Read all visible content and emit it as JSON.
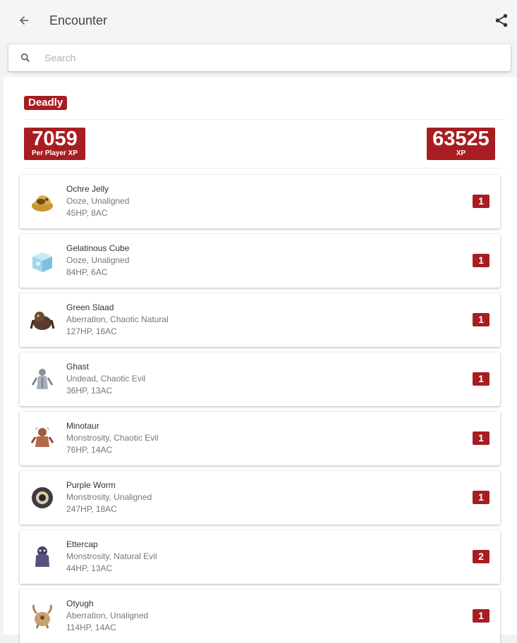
{
  "appbar": {
    "title": "Encounter"
  },
  "search": {
    "placeholder": "Search",
    "value": ""
  },
  "encounter": {
    "difficulty": "Deadly",
    "per_player_xp": "7059",
    "per_player_xp_label": "Per Player XP",
    "total_xp": "63525",
    "total_xp_label": "XP"
  },
  "colors": {
    "accent": "#a71d21"
  },
  "monsters": [
    {
      "name": "Ochre Jelly",
      "type": "Ooze, Unaligned",
      "stats": "45HP, 8AC",
      "count": "1",
      "icon": "ochre-jelly-icon"
    },
    {
      "name": "Gelatinous Cube",
      "type": "Ooze, Unaligned",
      "stats": "84HP, 6AC",
      "count": "1",
      "icon": "gelatinous-cube-icon"
    },
    {
      "name": "Green Slaad",
      "type": "Aberration, Chaotic Natural",
      "stats": "127HP, 16AC",
      "count": "1",
      "icon": "green-slaad-icon"
    },
    {
      "name": "Ghast",
      "type": "Undead, Chaotic Evil",
      "stats": "36HP, 13AC",
      "count": "1",
      "icon": "ghast-icon"
    },
    {
      "name": "Minotaur",
      "type": "Monstrosity, Chaotic Evil",
      "stats": "76HP, 14AC",
      "count": "1",
      "icon": "minotaur-icon"
    },
    {
      "name": "Purple Worm",
      "type": "Monstrosity, Unaligned",
      "stats": "247HP, 18AC",
      "count": "1",
      "icon": "purple-worm-icon"
    },
    {
      "name": "Ettercap",
      "type": "Monstrosity, Natural Evil",
      "stats": "44HP, 13AC",
      "count": "2",
      "icon": "ettercap-icon"
    },
    {
      "name": "Otyugh",
      "type": "Aberration, Unaligned",
      "stats": "114HP, 14AC",
      "count": "1",
      "icon": "otyugh-icon"
    }
  ]
}
